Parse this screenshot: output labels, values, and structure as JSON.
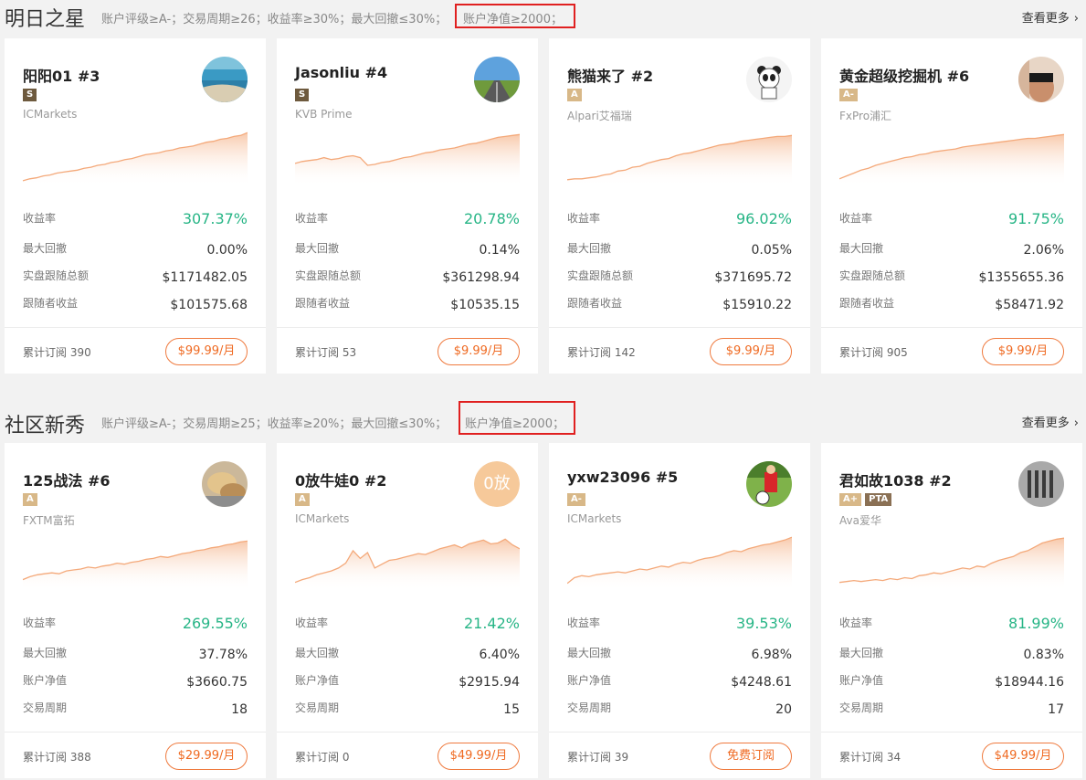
{
  "colors": {
    "accent": "#ef6a22",
    "positive": "#27b586",
    "highlight": "#e02020",
    "chart_line": "#f4a97a"
  },
  "sections": [
    {
      "title": "明日之星",
      "criteria": "账户评级≥A-；交易周期≥26；收益率≥30%；最大回撤≤30%；",
      "highlight": "账户净值≥2000；",
      "more": "查看更多",
      "more_icon": "chevron-right-icon",
      "cards": [
        {
          "name": "阳阳01 #3",
          "badges": [
            "S"
          ],
          "broker": "ICMarkets",
          "avatar": "sea-landscape",
          "chart": [
            2,
            4,
            5,
            7,
            8,
            10,
            11,
            12,
            13,
            15,
            16,
            18,
            19,
            21,
            22,
            24,
            25,
            27,
            29,
            30,
            31,
            33,
            34,
            36,
            37,
            38,
            40,
            42,
            43,
            45,
            46,
            48,
            49,
            52
          ],
          "stats": [
            {
              "label": "收益率",
              "value": "307.37%"
            },
            {
              "label": "最大回撤",
              "value": "0.00%"
            },
            {
              "label": "实盘跟随总额",
              "value": "$1171482.05"
            },
            {
              "label": "跟随者收益",
              "value": "$101575.68"
            }
          ],
          "subs": "累计订阅 390",
          "price": "$99.99/月"
        },
        {
          "name": "Jasonliu #4",
          "badges": [
            "S"
          ],
          "broker": "KVB Prime",
          "avatar": "road-landscape",
          "chart": [
            20,
            22,
            23,
            24,
            26,
            24,
            25,
            27,
            28,
            26,
            18,
            19,
            21,
            22,
            24,
            26,
            27,
            29,
            31,
            32,
            34,
            35,
            36,
            38,
            40,
            41,
            43,
            45,
            47,
            48,
            49,
            50
          ],
          "stats": [
            {
              "label": "收益率",
              "value": "20.78%"
            },
            {
              "label": "最大回撤",
              "value": "0.14%"
            },
            {
              "label": "实盘跟随总额",
              "value": "$361298.94"
            },
            {
              "label": "跟随者收益",
              "value": "$10535.15"
            }
          ],
          "subs": "累计订阅 53",
          "price": "$9.99/月"
        },
        {
          "name": "熊猫来了 #2",
          "badges": [
            "A"
          ],
          "broker": "Alpari艾福瑞",
          "avatar": "panda-cartoon",
          "chart": [
            3,
            4,
            4,
            5,
            6,
            8,
            9,
            12,
            13,
            16,
            17,
            20,
            22,
            24,
            25,
            28,
            30,
            31,
            33,
            35,
            37,
            39,
            40,
            41,
            43,
            44,
            45,
            46,
            47,
            48,
            48,
            49
          ],
          "stats": [
            {
              "label": "收益率",
              "value": "96.02%"
            },
            {
              "label": "最大回撤",
              "value": "0.05%"
            },
            {
              "label": "实盘跟随总额",
              "value": "$371695.72"
            },
            {
              "label": "跟随者收益",
              "value": "$15910.22"
            }
          ],
          "subs": "累计订阅 142",
          "price": "$9.99/月"
        },
        {
          "name": "黄金超级挖掘机 #6",
          "badges": [
            "A-"
          ],
          "broker": "FxPro浦汇",
          "avatar": "fitness-photo",
          "chart": [
            4,
            7,
            10,
            13,
            15,
            18,
            20,
            22,
            24,
            26,
            27,
            29,
            30,
            32,
            33,
            34,
            35,
            37,
            38,
            39,
            40,
            41,
            42,
            43,
            44,
            45,
            46,
            46,
            47,
            48,
            49,
            50
          ],
          "stats": [
            {
              "label": "收益率",
              "value": "91.75%"
            },
            {
              "label": "最大回撤",
              "value": "2.06%"
            },
            {
              "label": "实盘跟随总额",
              "value": "$1355655.36"
            },
            {
              "label": "跟随者收益",
              "value": "$58471.92"
            }
          ],
          "subs": "累计订阅 905",
          "price": "$9.99/月"
        }
      ]
    },
    {
      "title": "社区新秀",
      "criteria": "账户评级≥A-；交易周期≥25；收益率≥20%；最大回撤≤30%；",
      "highlight": "账户净值≥2000；",
      "more": "查看更多",
      "more_icon": "chevron-right-icon",
      "cards": [
        {
          "name": "125战法 #6",
          "badges": [
            "A"
          ],
          "broker": "FXTM富拓",
          "avatar": "bread-photo",
          "chart": [
            8,
            11,
            13,
            14,
            15,
            14,
            17,
            18,
            19,
            21,
            20,
            22,
            23,
            25,
            24,
            26,
            27,
            29,
            30,
            32,
            31,
            33,
            35,
            36,
            38,
            39,
            41,
            42,
            44,
            45,
            47,
            48
          ],
          "stats": [
            {
              "label": "收益率",
              "value": "269.55%"
            },
            {
              "label": "最大回撤",
              "value": "37.78%"
            },
            {
              "label": "账户净值",
              "value": "$3660.75"
            },
            {
              "label": "交易周期",
              "value": "18"
            }
          ],
          "subs": "累计订阅 388",
          "price": "$29.99/月"
        },
        {
          "name": "0放牛娃0 #2",
          "badges": [
            "A"
          ],
          "broker": "ICMarkets",
          "avatar": "text-avatar",
          "avatar_text": "0放",
          "chart": [
            5,
            8,
            10,
            13,
            15,
            17,
            20,
            25,
            38,
            30,
            36,
            20,
            24,
            28,
            29,
            31,
            33,
            35,
            34,
            37,
            40,
            42,
            44,
            41,
            45,
            47,
            49,
            45,
            46,
            50,
            44,
            40
          ],
          "stats": [
            {
              "label": "收益率",
              "value": "21.42%"
            },
            {
              "label": "最大回撤",
              "value": "6.40%"
            },
            {
              "label": "账户净值",
              "value": "$2915.94"
            },
            {
              "label": "交易周期",
              "value": "15"
            }
          ],
          "subs": "累计订阅 0",
          "price": "$49.99/月"
        },
        {
          "name": "yxw23096 #5",
          "badges": [
            "A-"
          ],
          "broker": "ICMarkets",
          "avatar": "soccer-photo",
          "chart": [
            4,
            10,
            12,
            11,
            13,
            14,
            15,
            16,
            15,
            17,
            19,
            18,
            20,
            22,
            21,
            24,
            26,
            25,
            28,
            30,
            31,
            33,
            36,
            38,
            37,
            40,
            42,
            44,
            45,
            47,
            49,
            52
          ],
          "stats": [
            {
              "label": "收益率",
              "value": "39.53%"
            },
            {
              "label": "最大回撤",
              "value": "6.98%"
            },
            {
              "label": "账户净值",
              "value": "$4248.61"
            },
            {
              "label": "交易周期",
              "value": "20"
            }
          ],
          "subs": "累计订阅 39",
          "price": "免费订阅"
        },
        {
          "name": "君如故1038 #2",
          "badges": [
            "A+",
            "PTA"
          ],
          "broker": "Ava爱华",
          "avatar": "calligraphy-photo",
          "chart": [
            5,
            6,
            7,
            6,
            7,
            8,
            7,
            9,
            8,
            10,
            9,
            12,
            13,
            15,
            14,
            16,
            18,
            20,
            19,
            22,
            21,
            25,
            28,
            30,
            32,
            36,
            38,
            42,
            46,
            48,
            50,
            51
          ],
          "stats": [
            {
              "label": "收益率",
              "value": "81.99%"
            },
            {
              "label": "最大回撤",
              "value": "0.83%"
            },
            {
              "label": "账户净值",
              "value": "$18944.16"
            },
            {
              "label": "交易周期",
              "value": "17"
            }
          ],
          "subs": "累计订阅 34",
          "price": "$49.99/月"
        }
      ]
    }
  ]
}
